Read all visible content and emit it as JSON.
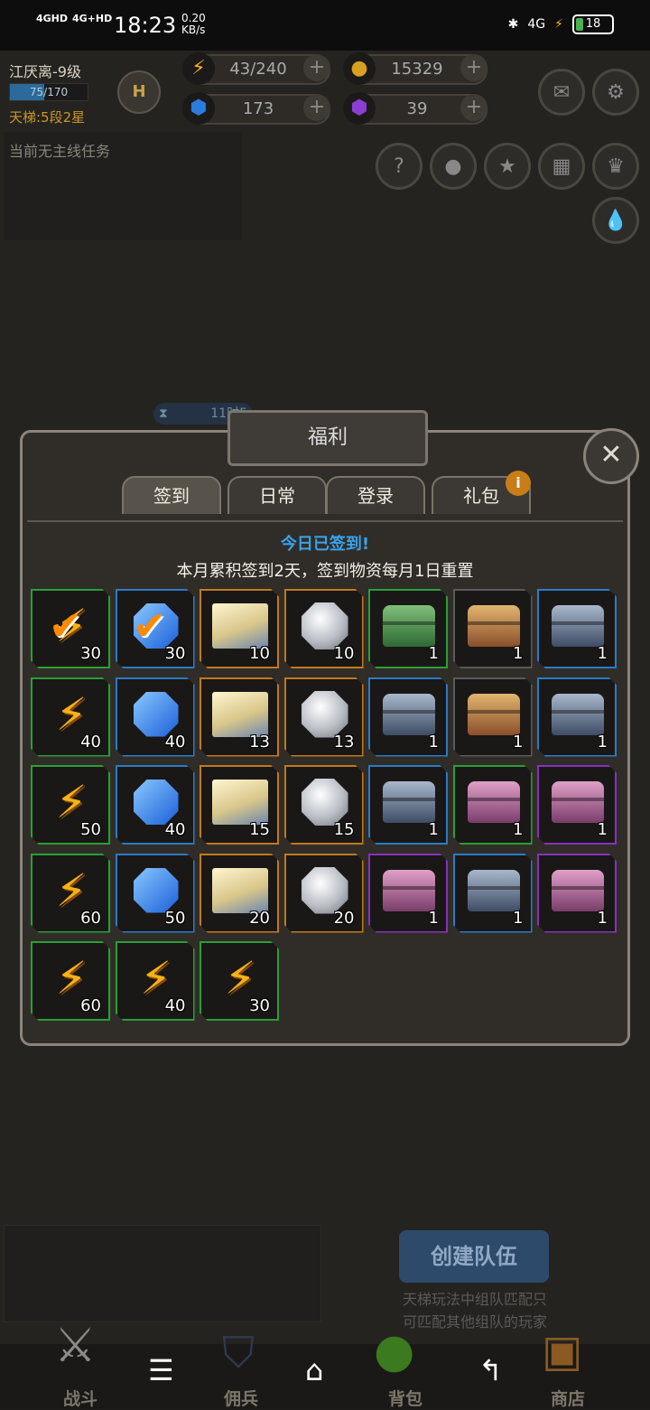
{
  "status": {
    "net1": "4GHD",
    "net2": "4G+HD",
    "time": "18:23",
    "speed_value": "0.20",
    "speed_unit": "KB/s",
    "right_net": "4G",
    "battery": "18"
  },
  "player": {
    "name": "江厌离-9级",
    "xp": "75/170",
    "xp_fraction": 0.44,
    "ladder": "天梯:5段2星",
    "badge": "H"
  },
  "resources": {
    "energy": "43/240",
    "gold": "15329",
    "gems": "173",
    "purple": "39"
  },
  "quest": {
    "text": "当前无主线任务"
  },
  "timer": "11时5",
  "panel": {
    "title": "福利",
    "tabs": [
      "签到",
      "日常",
      "登录",
      "礼包"
    ],
    "message_signed": "今日已签到!",
    "message_monthly": "本月累积签到2天，签到物资每月1日重置"
  },
  "rewards": [
    {
      "type": "energy",
      "qty": "30",
      "frame": "green",
      "claimed": true
    },
    {
      "type": "gem",
      "qty": "30",
      "frame": "blue",
      "claimed": true
    },
    {
      "type": "book",
      "qty": "10",
      "frame": "orange"
    },
    {
      "type": "diamond",
      "qty": "10",
      "frame": "orange"
    },
    {
      "type": "chest-green",
      "qty": "1",
      "frame": "green"
    },
    {
      "type": "chest-gold",
      "qty": "1",
      "frame": "gray"
    },
    {
      "type": "chest-steel",
      "qty": "1",
      "frame": "blue"
    },
    {
      "type": "energy",
      "qty": "40",
      "frame": "green"
    },
    {
      "type": "gem",
      "qty": "40",
      "frame": "blue"
    },
    {
      "type": "book",
      "qty": "13",
      "frame": "orange"
    },
    {
      "type": "diamond",
      "qty": "13",
      "frame": "orange"
    },
    {
      "type": "chest-steel",
      "qty": "1",
      "frame": "blue"
    },
    {
      "type": "chest-gold",
      "qty": "1",
      "frame": "gray"
    },
    {
      "type": "chest-steel",
      "qty": "1",
      "frame": "blue"
    },
    {
      "type": "energy",
      "qty": "50",
      "frame": "green"
    },
    {
      "type": "gem",
      "qty": "40",
      "frame": "blue"
    },
    {
      "type": "book",
      "qty": "15",
      "frame": "orange"
    },
    {
      "type": "diamond",
      "qty": "15",
      "frame": "orange"
    },
    {
      "type": "chest-steel",
      "qty": "1",
      "frame": "blue"
    },
    {
      "type": "chest-pink",
      "qty": "1",
      "frame": "green"
    },
    {
      "type": "chest-pink",
      "qty": "1",
      "frame": "purple"
    },
    {
      "type": "energy",
      "qty": "60",
      "frame": "green"
    },
    {
      "type": "gem",
      "qty": "50",
      "frame": "blue"
    },
    {
      "type": "book",
      "qty": "20",
      "frame": "orange"
    },
    {
      "type": "diamond",
      "qty": "20",
      "frame": "orange"
    },
    {
      "type": "chest-pink",
      "qty": "1",
      "frame": "purple"
    },
    {
      "type": "chest-steel",
      "qty": "1",
      "frame": "blue"
    },
    {
      "type": "chest-pink",
      "qty": "1",
      "frame": "purple"
    },
    {
      "type": "energy",
      "qty": "60",
      "frame": "green"
    },
    {
      "type": "energy",
      "qty": "40",
      "frame": "green"
    },
    {
      "type": "energy",
      "qty": "30",
      "frame": "green"
    }
  ],
  "bottom": {
    "create_team": "创建队伍",
    "ladder_hint_1": "天梯玩法中组队匹配只",
    "ladder_hint_2": "可匹配其他组队的玩家"
  },
  "nav": {
    "battle": "战斗",
    "mercenary": "佣兵",
    "backpack": "背包",
    "shop": "商店"
  },
  "icons": [
    "mail-icon",
    "gear-icon",
    "help-icon",
    "profile-icon",
    "star-icon",
    "calendar-icon",
    "trophy-icon",
    "drop-icon",
    "close-icon",
    "info-icon"
  ],
  "colors": {
    "frame_green": "#27a036",
    "frame_blue": "#2a7bc8",
    "frame_orange": "#c2791c",
    "frame_purple": "#8a2fc0",
    "frame_gray": "#5a5a5a",
    "signed_text": "#39a4ee"
  }
}
